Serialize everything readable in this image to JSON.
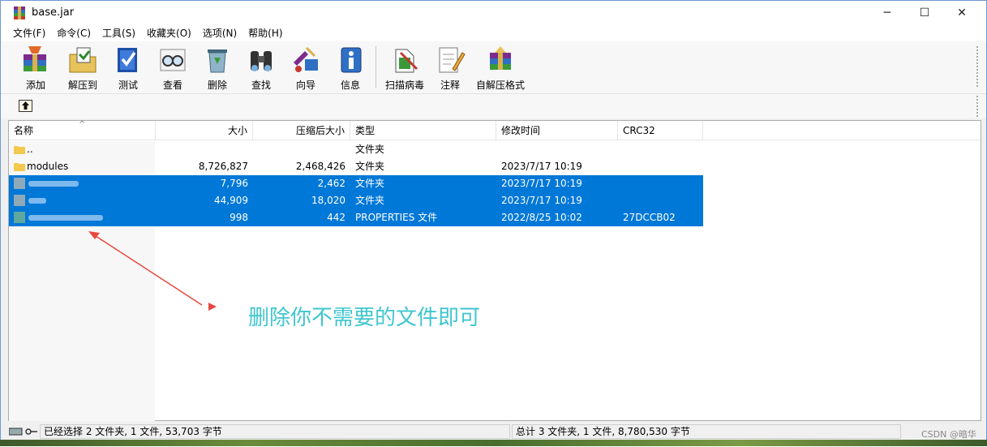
{
  "window": {
    "title": "base.jar"
  },
  "menu": [
    "文件(F)",
    "命令(C)",
    "工具(S)",
    "收藏夹(O)",
    "选项(N)",
    "帮助(H)"
  ],
  "toolbar": {
    "add": "添加",
    "extract": "解压到",
    "test": "测试",
    "view": "查看",
    "delete": "删除",
    "find": "查找",
    "wizard": "向导",
    "info": "信息",
    "virus_scan": "扫描病毒",
    "comment": "注释",
    "sfx": "自解压格式"
  },
  "columns": {
    "name": "名称",
    "size": "大小",
    "packed": "压缩后大小",
    "type": "类型",
    "modified": "修改时间",
    "crc": "CRC32"
  },
  "rows": [
    {
      "name": "..",
      "size": "",
      "packed": "",
      "type": "文件夹",
      "modified": "",
      "crc": ""
    },
    {
      "name": "modules",
      "size": "8,726,827",
      "packed": "2,468,426",
      "type": "文件夹",
      "modified": "2023/7/17 10:19",
      "crc": ""
    },
    {
      "name": "",
      "size": "7,796",
      "packed": "2,462",
      "type": "文件夹",
      "modified": "2023/7/17 10:19",
      "crc": ""
    },
    {
      "name": "",
      "size": "44,909",
      "packed": "18,020",
      "type": "文件夹",
      "modified": "2023/7/17 10:19",
      "crc": ""
    },
    {
      "name": "",
      "size": "998",
      "packed": "442",
      "type": "PROPERTIES 文件",
      "modified": "2022/8/25 10:02",
      "crc": "27DCCB02"
    }
  ],
  "annotation": {
    "text": "删除你不需要的文件即可",
    "color": "#3fc6d0"
  },
  "status": {
    "selected": "已经选择 2 文件夹, 1 文件, 53,703 字节",
    "total": "总计 3 文件夹, 1 文件, 8,780,530 字节"
  },
  "watermark": "CSDN @暗华",
  "colors": {
    "selection": "#0078d7",
    "arrow": "#e8473f"
  }
}
